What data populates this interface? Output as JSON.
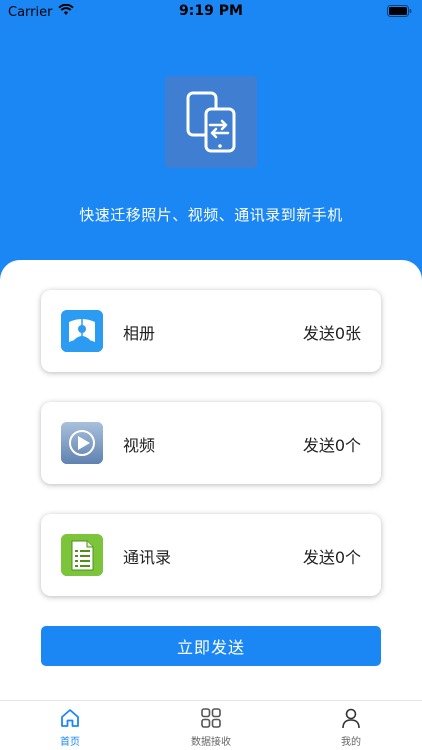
{
  "status_bar": {
    "carrier": "Carrier",
    "time": "9:19 PM"
  },
  "hero": {
    "tagline": "快速迁移照片、视频、通讯录到新手机"
  },
  "items": [
    {
      "label": "相册",
      "status": "发送0张",
      "icon": "photo-album-icon"
    },
    {
      "label": "视频",
      "status": "发送0个",
      "icon": "video-play-icon"
    },
    {
      "label": "通讯录",
      "status": "发送0个",
      "icon": "contacts-document-icon"
    }
  ],
  "send_button": {
    "label": "立即发送"
  },
  "tabbar": {
    "tabs": [
      {
        "label": "首页",
        "icon": "home-icon",
        "active": true
      },
      {
        "label": "数据接收",
        "icon": "grid-icon",
        "active": false
      },
      {
        "label": "我的",
        "icon": "user-icon",
        "active": false
      }
    ]
  },
  "colors": {
    "primary": "#1b87f5"
  }
}
